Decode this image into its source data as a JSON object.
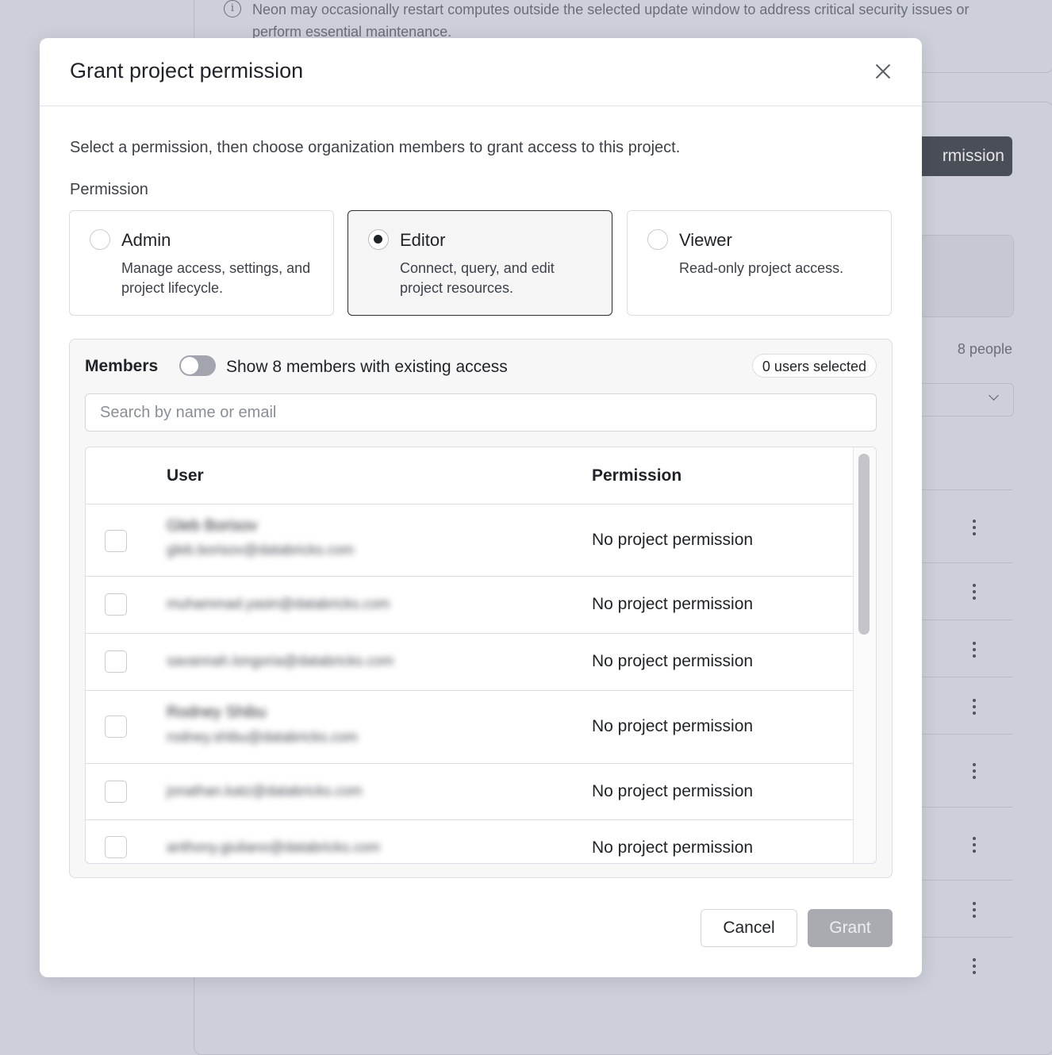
{
  "background": {
    "notice_text": "Neon may occasionally restart computes outside the selected update window to address critical security issues or perform essential maintenance.",
    "partial_button_label": "rmission",
    "people_count": "8 people"
  },
  "modal": {
    "title": "Grant project permission",
    "description": "Select a permission, then choose organization members to grant access to this project.",
    "permission_label": "Permission",
    "options": [
      {
        "title": "Admin",
        "description": "Manage access, settings, and project lifecycle.",
        "selected": false
      },
      {
        "title": "Editor",
        "description": "Connect, query, and edit project resources.",
        "selected": true
      },
      {
        "title": "Viewer",
        "description": "Read-only project access.",
        "selected": false
      }
    ],
    "members": {
      "title": "Members",
      "toggle_label": "Show 8 members with existing access",
      "toggle_on": false,
      "selected_badge": "0 users selected",
      "search_placeholder": "Search by name or email",
      "columns": {
        "user": "User",
        "permission": "Permission"
      },
      "rows": [
        {
          "name": "Gleb Borisov",
          "email": "gleb.borisov@databricks.com",
          "permission": "No project permission"
        },
        {
          "name": "",
          "email": "muhammad.yasin@databricks.com",
          "permission": "No project permission"
        },
        {
          "name": "",
          "email": "savannah.longoria@databricks.com",
          "permission": "No project permission"
        },
        {
          "name": "Rodney Shibu",
          "email": "rodney.shibu@databricks.com",
          "permission": "No project permission"
        },
        {
          "name": "",
          "email": "jonathan.katz@databricks.com",
          "permission": "No project permission"
        },
        {
          "name": "",
          "email": "anthony.giuliano@databricks.com",
          "permission": "No project permission"
        }
      ]
    },
    "buttons": {
      "cancel": "Cancel",
      "grant": "Grant"
    }
  }
}
